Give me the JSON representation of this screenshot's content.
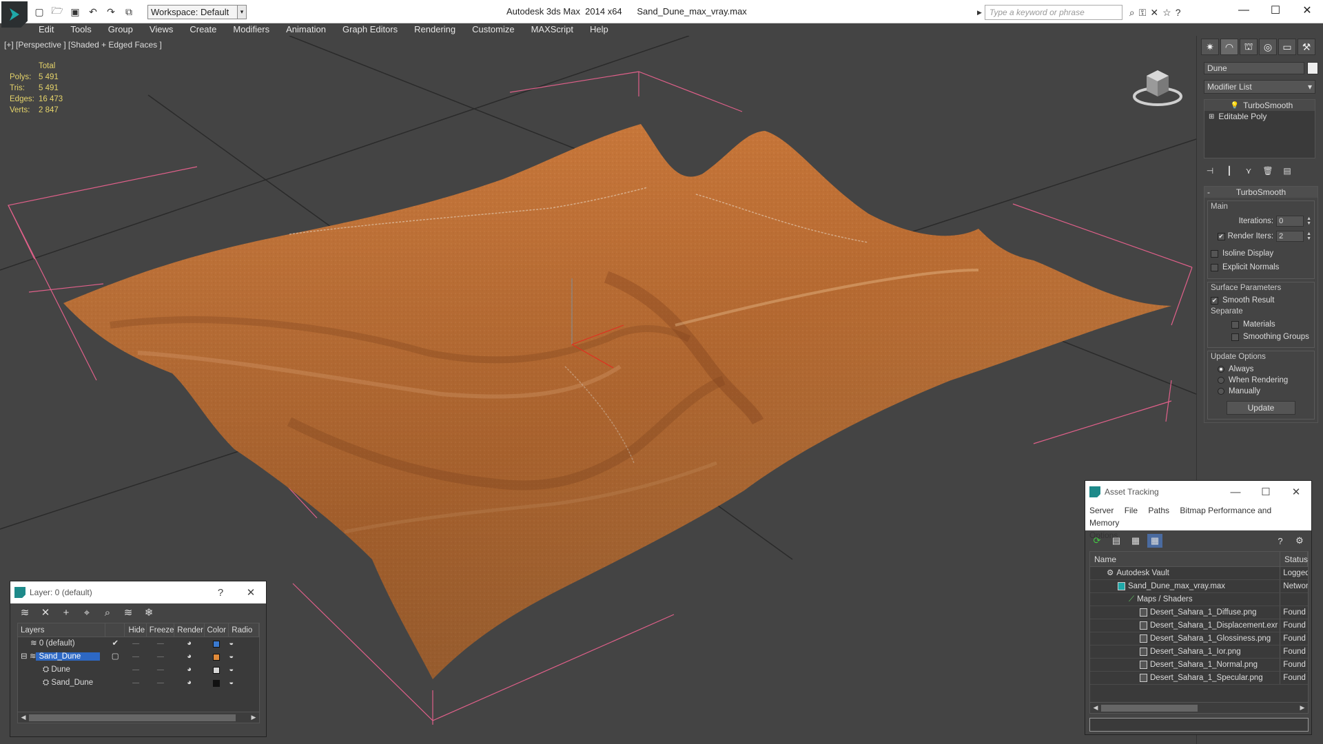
{
  "titlebar": {
    "workspace": "Workspace: Default",
    "app_title": "Autodesk 3ds Max  2014 x64",
    "file_name": "Sand_Dune_max_vray.max",
    "search_placeholder": "Type a keyword or phrase"
  },
  "menubar": {
    "items": [
      "Edit",
      "Tools",
      "Group",
      "Views",
      "Create",
      "Modifiers",
      "Animation",
      "Graph Editors",
      "Rendering",
      "Customize",
      "MAXScript",
      "Help"
    ]
  },
  "viewport": {
    "label": "[+] [Perspective ] [Shaded + Edged Faces ]",
    "stats": {
      "header": "Total",
      "rows": [
        {
          "key": "Polys:",
          "value": "5 491"
        },
        {
          "key": "Tris:",
          "value": "5 491"
        },
        {
          "key": "Edges:",
          "value": "16 473"
        },
        {
          "key": "Verts:",
          "value": "2 847"
        }
      ]
    },
    "colors": {
      "sand": "#c8763a",
      "bbox": "#e0608a",
      "grid": "#2a2a2a"
    }
  },
  "command_panel": {
    "object_name": "Dune",
    "modifier_list": "Modifier List",
    "stack": [
      "TurboSmooth",
      "Editable Poly"
    ],
    "turbosmooth": {
      "title": "TurboSmooth",
      "main_label": "Main",
      "iterations_label": "Iterations:",
      "iterations_value": "0",
      "render_iters_label": "Render Iters:",
      "render_iters_value": "2",
      "isoline_label": "Isoline Display",
      "explicit_label": "Explicit Normals",
      "surface_label": "Surface Parameters",
      "smooth_label": "Smooth Result",
      "separate_label": "Separate",
      "materials_label": "Materials",
      "smoothing_groups_label": "Smoothing Groups",
      "update_options_label": "Update Options",
      "always_label": "Always",
      "when_rendering_label": "When Rendering",
      "manually_label": "Manually",
      "update_button": "Update"
    }
  },
  "layer_window": {
    "title": "Layer: 0 (default)",
    "help": "?",
    "columns": [
      "Layers",
      "Hide",
      "Freeze",
      "Render",
      "Color",
      "Radio"
    ],
    "rows": [
      {
        "name": "0 (default)",
        "color": "#3a7ad0"
      },
      {
        "name": "Sand_Dune",
        "color": "#e08a3a"
      },
      {
        "name": "Dune",
        "color": "#d8d8d8"
      },
      {
        "name": "Sand_Dune",
        "color": "#111111"
      }
    ]
  },
  "asset_window": {
    "title": "Asset Tracking",
    "menu_line1": [
      "Server",
      "File",
      "Paths",
      "Bitmap Performance and Memory"
    ],
    "menu_line2": [
      "Options"
    ],
    "columns": [
      "Name",
      "Status"
    ],
    "rows": [
      {
        "name": "Autodesk Vault",
        "status": "Logged",
        "indent": 1
      },
      {
        "name": "Sand_Dune_max_vray.max",
        "status": "Networ",
        "indent": 2
      },
      {
        "name": "Maps / Shaders",
        "status": "",
        "indent": 3
      },
      {
        "name": "Desert_Sahara_1_Diffuse.png",
        "status": "Found",
        "indent": 4
      },
      {
        "name": "Desert_Sahara_1_Displacement.exr",
        "status": "Found",
        "indent": 4
      },
      {
        "name": "Desert_Sahara_1_Glossiness.png",
        "status": "Found",
        "indent": 4
      },
      {
        "name": "Desert_Sahara_1_Ior.png",
        "status": "Found",
        "indent": 4
      },
      {
        "name": "Desert_Sahara_1_Normal.png",
        "status": "Found",
        "indent": 4
      },
      {
        "name": "Desert_Sahara_1_Specular.png",
        "status": "Found",
        "indent": 4
      }
    ]
  }
}
